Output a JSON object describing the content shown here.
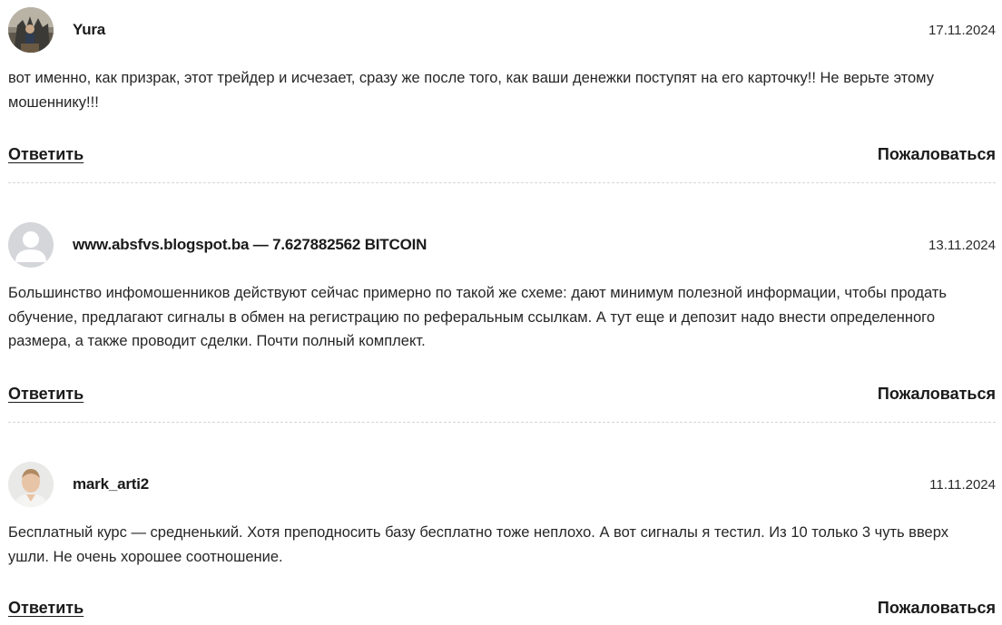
{
  "comments": [
    {
      "author": "Yura",
      "date": "17.11.2024",
      "avatar_icon": "user-photo-icon",
      "text": "вот именно, как призрак, этот трейдер и исчезает, сразу же после того, как ваши денежки поступят на его карточку!! Не верьте этому мошеннику!!!",
      "reply_label": "Ответить",
      "report_label": "Пожаловаться"
    },
    {
      "author": "www.absfvs.blogspot.ba — 7.627882562 BITCOIN",
      "date": "13.11.2024",
      "avatar_icon": "default-user-icon",
      "text": "Большинство инфомошенников действуют сейчас примерно по такой же схеме: дают минимум полезной информации, чтобы продать обучение, предлагают сигналы в обмен на регистрацию по реферальным ссылкам. А тут еще и депозит надо внести определенного размера, а также проводит сделки. Почти полный комплект.",
      "reply_label": "Ответить",
      "report_label": "Пожаловаться"
    },
    {
      "author": "mark_arti2",
      "date": "11.11.2024",
      "avatar_icon": "user-photo-icon",
      "text": "Бесплатный курс — средненький. Хотя преподносить базу бесплатно тоже неплохо. А вот сигналы я тестил. Из 10 только 3 чуть вверх ушли. Не очень хорошее соотношение.",
      "reply_label": "Ответить",
      "report_label": "Пожаловаться"
    }
  ]
}
